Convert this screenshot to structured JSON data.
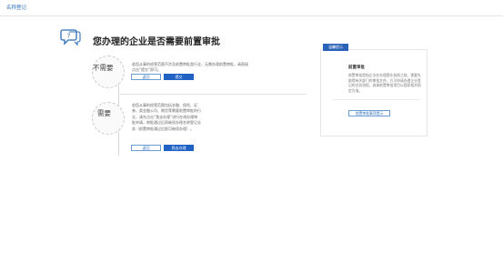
{
  "topbar": {
    "title": "名称登记"
  },
  "header": {
    "title": "您办理的企业是否需要前置审批",
    "icon": "chat-bubble-question-icon"
  },
  "option_no": {
    "label": "不需要",
    "description": "若您从事的经营范围不涉及前置审批类行业，无需办理前置审批，请直接点击“提交”即可。",
    "back_label": "返回",
    "submit_label": "提交"
  },
  "option_yes": {
    "label": "需要",
    "description": "若您从事的经营范围包括金融、保险、证券、类金融公司、期货等需要前置审批的行业，请先点击“我去办理”进行在线办理审批申请，审批通过后再继续办理名称登记业务（前置审批通过后即可继续办理）。",
    "back_label": "返回",
    "go_label": "我去办理"
  },
  "side_panel": {
    "tab": "温馨提示",
    "heading": "前置审批",
    "text": "前置审批是指企业在办理营业执照之前，需要先取得有关部门的审批文件，方可申请办理企业登记的业务流程，具体前置审批项目以国家相关规定为准。",
    "button_label": "前置审批事项提示"
  },
  "colors": {
    "accent": "#1f62c4",
    "tab": "#2a63b7",
    "link": "#2f6fb8"
  }
}
